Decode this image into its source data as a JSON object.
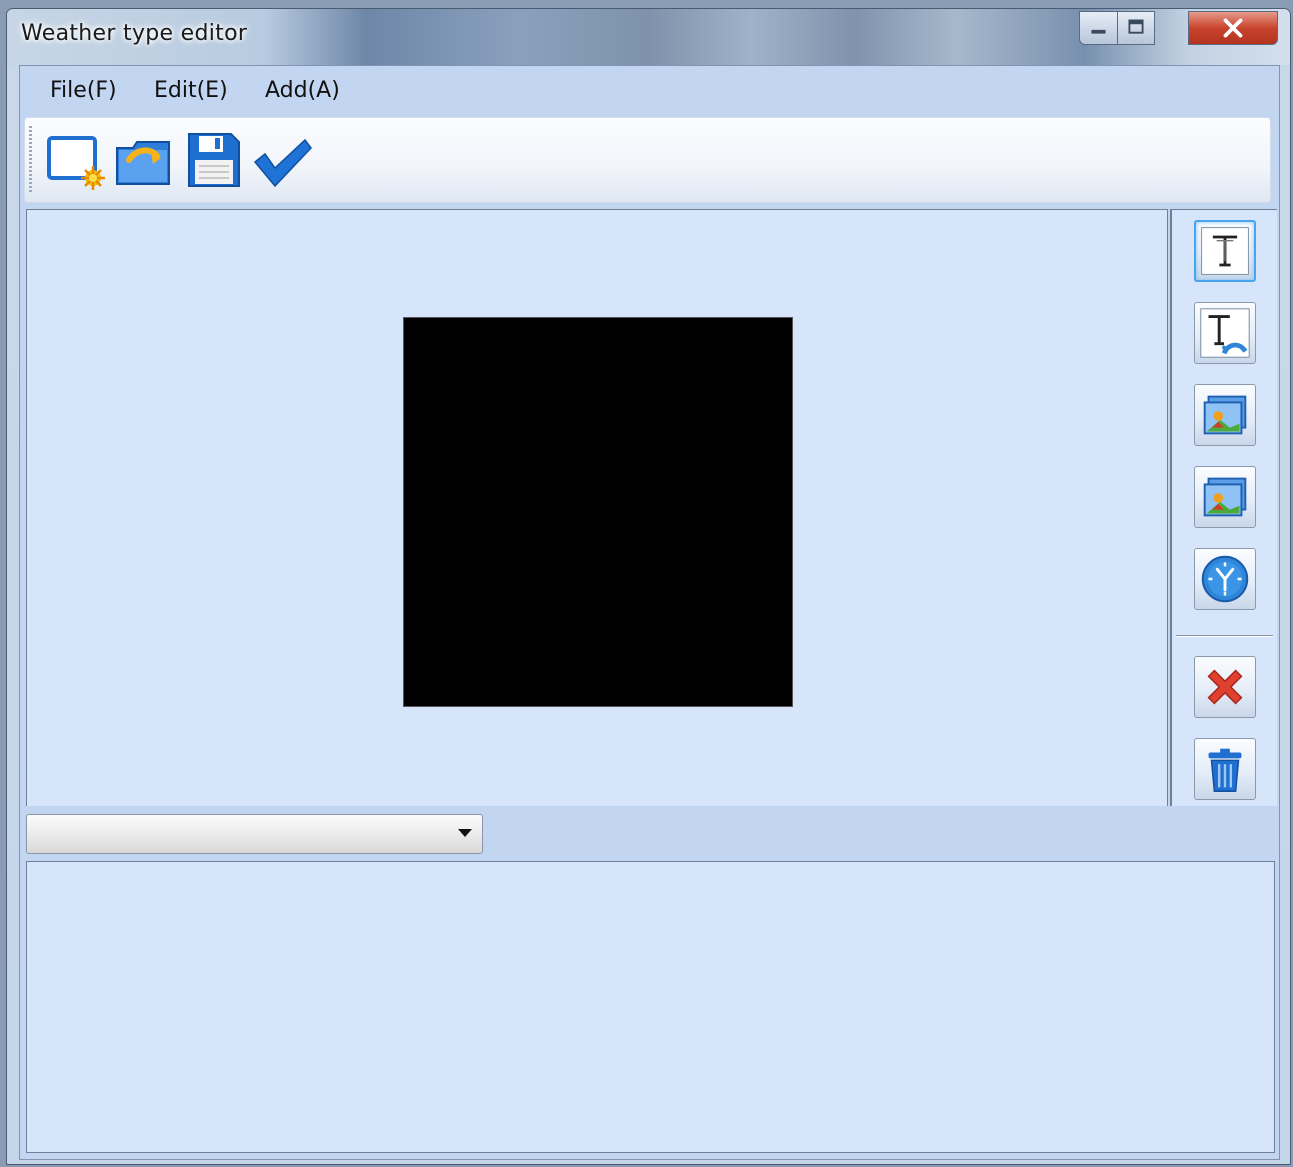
{
  "window": {
    "title": "Weather type editor",
    "controls": {
      "minimize": "minimize",
      "maximize": "maximize",
      "close": "x"
    }
  },
  "menu": {
    "items": [
      {
        "label": "File(F)"
      },
      {
        "label": "Edit(E)"
      },
      {
        "label": "Add(A)"
      }
    ]
  },
  "toolbar": {
    "buttons": [
      "new-icon",
      "open-folder-icon",
      "save-icon",
      "apply-checkmark-icon"
    ]
  },
  "side_tools": {
    "buttons": [
      "text-icon",
      "dynamic-text-icon",
      "image-icon",
      "image-animation-icon",
      "clock-icon",
      "delete-icon",
      "trash-icon"
    ],
    "active": "text-icon"
  },
  "element_selector": {
    "selected_value": ""
  },
  "colors": {
    "accent": "#2f86d8",
    "client_background": "#c2d6f2",
    "panel_background": "#d6e5f9",
    "preview_background": "#000000",
    "close_button": "#c9442e"
  }
}
